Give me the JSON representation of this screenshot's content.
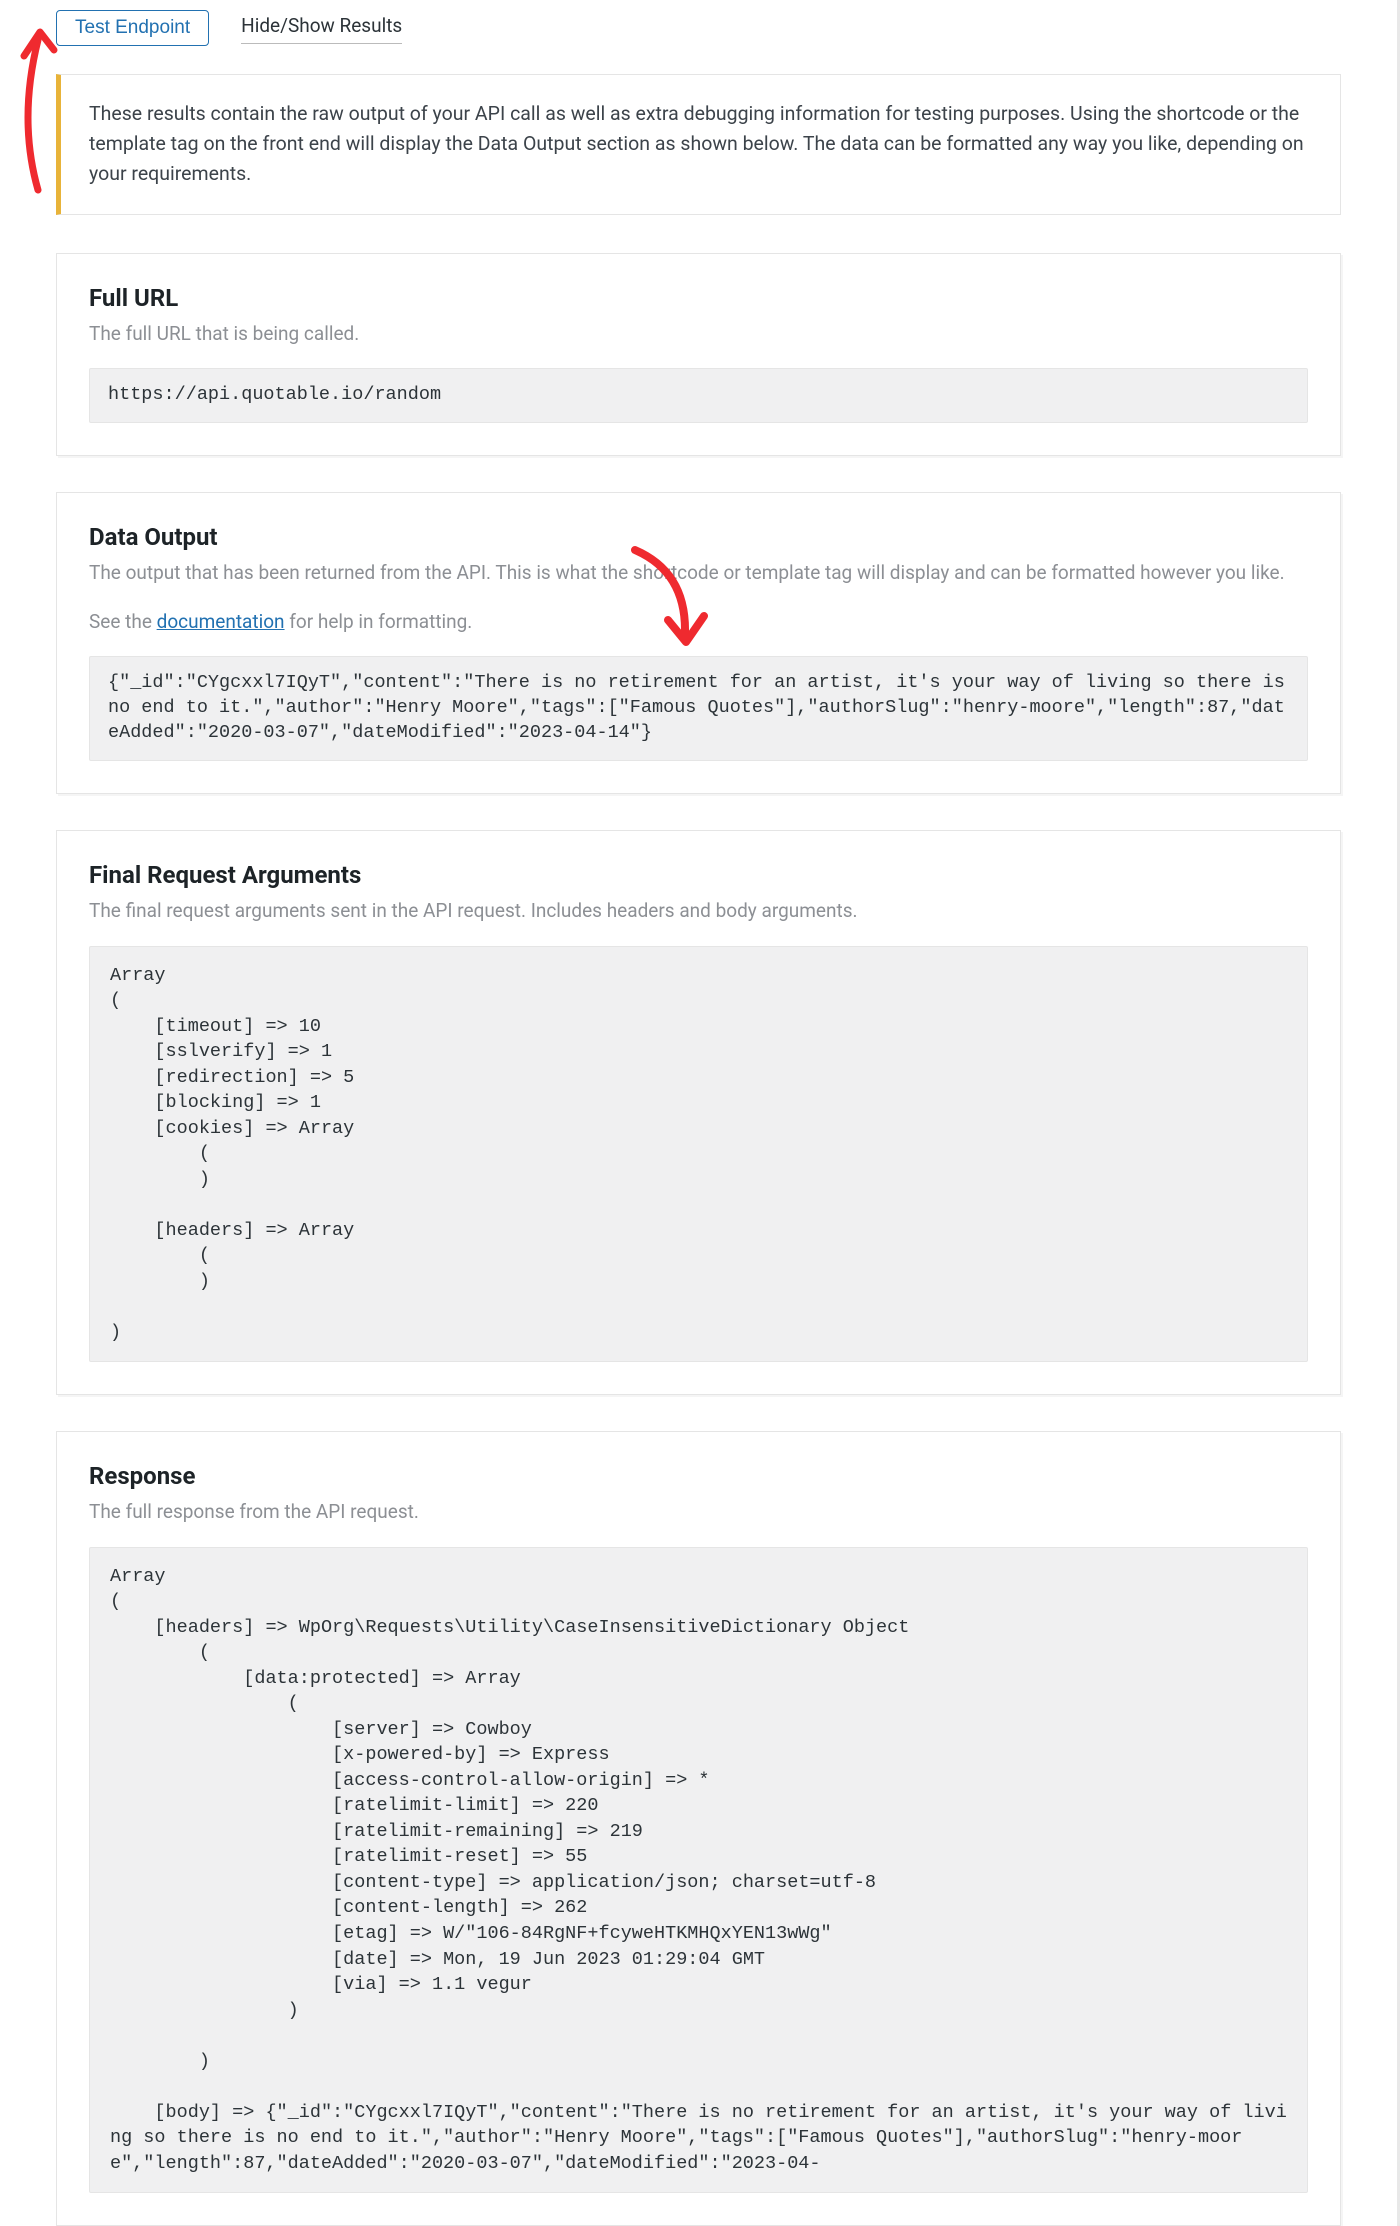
{
  "tabs": {
    "test_endpoint_label": "Test Endpoint",
    "hide_show_label": "Hide/Show Results"
  },
  "info_box": {
    "text": "These results contain the raw output of your API call as well as extra debugging information for testing purposes. Using the shortcode or the template tag on the front end will display the Data Output section as shown below. The data can be formatted any way you like, depending on your requirements."
  },
  "full_url": {
    "title": "Full URL",
    "subtitle": "The full URL that is being called.",
    "code": "https://api.quotable.io/random"
  },
  "data_output": {
    "title": "Data Output",
    "subtitle": "The output that has been returned from the API. This is what the shortcode or template tag will display and can be formatted however you like.",
    "note_prefix": "See the ",
    "note_link": "documentation",
    "note_suffix": " for help in formatting.",
    "code": "{\"_id\":\"CYgcxxl7IQyT\",\"content\":\"There is no retirement for an artist, it's your way of living so there is no end to it.\",\"author\":\"Henry Moore\",\"tags\":[\"Famous Quotes\"],\"authorSlug\":\"henry-moore\",\"length\":87,\"dateAdded\":\"2020-03-07\",\"dateModified\":\"2023-04-14\"}"
  },
  "final_request": {
    "title": "Final Request Arguments",
    "subtitle": "The final request arguments sent in the API request. Includes headers and body arguments.",
    "code": "Array\n(\n    [timeout] => 10\n    [sslverify] => 1\n    [redirection] => 5\n    [blocking] => 1\n    [cookies] => Array\n        (\n        )\n\n    [headers] => Array\n        (\n        )\n\n)"
  },
  "response": {
    "title": "Response",
    "subtitle": "The full response from the API request.",
    "code": "Array\n(\n    [headers] => WpOrg\\Requests\\Utility\\CaseInsensitiveDictionary Object\n        (\n            [data:protected] => Array\n                (\n                    [server] => Cowboy\n                    [x-powered-by] => Express\n                    [access-control-allow-origin] => *\n                    [ratelimit-limit] => 220\n                    [ratelimit-remaining] => 219\n                    [ratelimit-reset] => 55\n                    [content-type] => application/json; charset=utf-8\n                    [content-length] => 262\n                    [etag] => W/\"106-84RgNF+fcyweHTKMHQxYEN13wWg\"\n                    [date] => Mon, 19 Jun 2023 01:29:04 GMT\n                    [via] => 1.1 vegur\n                )\n\n        )\n\n    [body] => {\"_id\":\"CYgcxxl7IQyT\",\"content\":\"There is no retirement for an artist, it's your way of living so there is no end to it.\",\"author\":\"Henry Moore\",\"tags\":[\"Famous Quotes\"],\"authorSlug\":\"henry-moore\",\"length\":87,\"dateAdded\":\"2020-03-07\",\"dateModified\":\"2023-04-"
  }
}
